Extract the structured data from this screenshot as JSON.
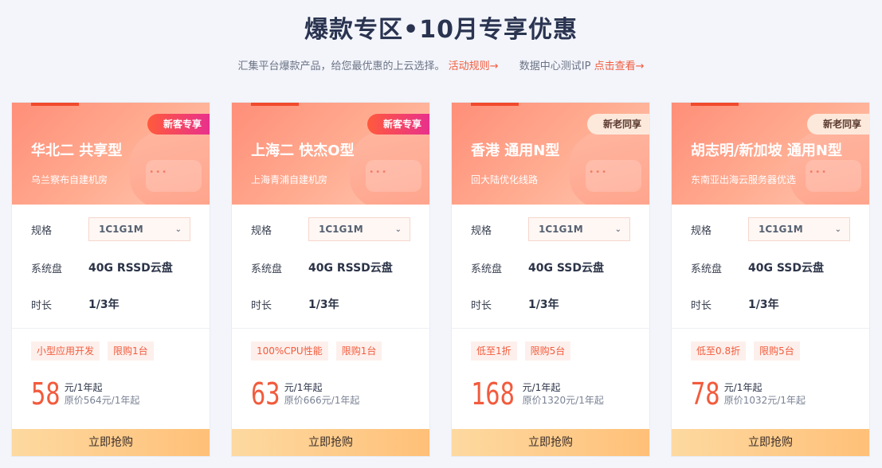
{
  "header": {
    "title": "爆款专区•10月专享优惠",
    "subtitle_text": "汇集平台爆款产品，给您最优惠的上云选择。",
    "rules_link": "活动规则→",
    "ip_text": "数据中心测试IP",
    "ip_link": "点击查看→"
  },
  "labels": {
    "spec": "规格",
    "disk": "系统盘",
    "duration": "时长",
    "buy": "立即抢购",
    "price_unit": "元/1年起"
  },
  "cards": [
    {
      "badge": "新客专享",
      "badge_style": "new",
      "region": "华北二 共享型",
      "room": "乌兰察布自建机房",
      "spec": "1C1G1M",
      "disk": "40G RSSD云盘",
      "duration": "1/3年",
      "tags": [
        "小型应用开发",
        "限购1台"
      ],
      "price": "58",
      "original": "原价564元/1年起"
    },
    {
      "badge": "新客专享",
      "badge_style": "new",
      "region": "上海二 快杰O型",
      "room": "上海青浦自建机房",
      "spec": "1C1G1M",
      "disk": "40G RSSD云盘",
      "duration": "1/3年",
      "tags": [
        "100%CPU性能",
        "限购1台"
      ],
      "price": "63",
      "original": "原价666元/1年起"
    },
    {
      "badge": "新老同享",
      "badge_style": "old",
      "region": "香港 通用N型",
      "room": "回大陆优化线路",
      "spec": "1C1G1M",
      "disk": "40G SSD云盘",
      "duration": "1/3年",
      "tags": [
        "低至1折",
        "限购5台"
      ],
      "price": "168",
      "original": "原价1320元/1年起"
    },
    {
      "badge": "新老同享",
      "badge_style": "old",
      "region": "胡志明/新加坡 通用N型",
      "room": "东南亚出海云服务器优选",
      "spec": "1C1G1M",
      "disk": "40G SSD云盘",
      "duration": "1/3年",
      "tags": [
        "低至0.8折",
        "限购5台"
      ],
      "price": "78",
      "original": "原价1032元/1年起"
    }
  ],
  "colors": {
    "accent": "#f25b3d",
    "badge_new": "#ff5a3c",
    "badge_old": "#fde9dc",
    "buy_button": "#ffc078"
  },
  "icons": {
    "select_arrow": "chevron-down-icon"
  }
}
